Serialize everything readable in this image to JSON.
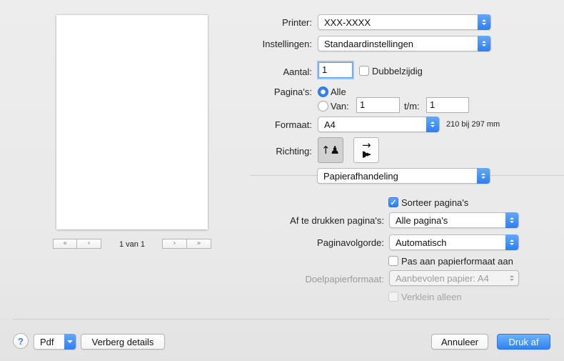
{
  "preview": {
    "page_indicator": "1 van 1",
    "first_icon": "«",
    "prev_icon": "‹",
    "next_icon": "›",
    "last_icon": "»"
  },
  "printer": {
    "label": "Printer:",
    "value": "XXX-XXXX"
  },
  "presets": {
    "label": "Instellingen:",
    "value": "Standaardinstellingen"
  },
  "copies": {
    "label": "Aantal:",
    "value": "1",
    "duplex_label": "Dubbelzijdig",
    "duplex_checked": false
  },
  "pages": {
    "label": "Pagina's:",
    "all_label": "Alle",
    "from_label": "Van:",
    "from_value": "1",
    "to_label": "t/m:",
    "to_value": "1",
    "selected": "all"
  },
  "paper_size": {
    "label": "Formaat:",
    "value": "A4",
    "dimensions": "210 bij 297 mm"
  },
  "orientation": {
    "label": "Richting:",
    "portrait_icon": "↑♟",
    "landscape_icon": "↑♟",
    "selected": "portrait"
  },
  "section": {
    "value": "Papierafhandeling"
  },
  "paper_handling": {
    "collate_label": "Sorteer pagina's",
    "collate_checked": true,
    "pages_to_print_label": "Af te drukken pagina's:",
    "pages_to_print_value": "Alle pagina's",
    "page_order_label": "Paginavolgorde:",
    "page_order_value": "Automatisch",
    "scale_to_fit_label": "Pas aan papierformaat aan",
    "scale_to_fit_checked": false,
    "destination_label": "Doelpapierformaat:",
    "destination_value": "Aanbevolen papier: A4",
    "scale_down_label": "Verklein alleen",
    "scale_down_checked": false
  },
  "footer": {
    "help_label": "?",
    "pdf_label": "Pdf",
    "hide_details_label": "Verberg details",
    "cancel_label": "Annuleer",
    "print_label": "Druk af"
  },
  "colors": {
    "accent": "#2f80f3",
    "background": "#ececec"
  }
}
